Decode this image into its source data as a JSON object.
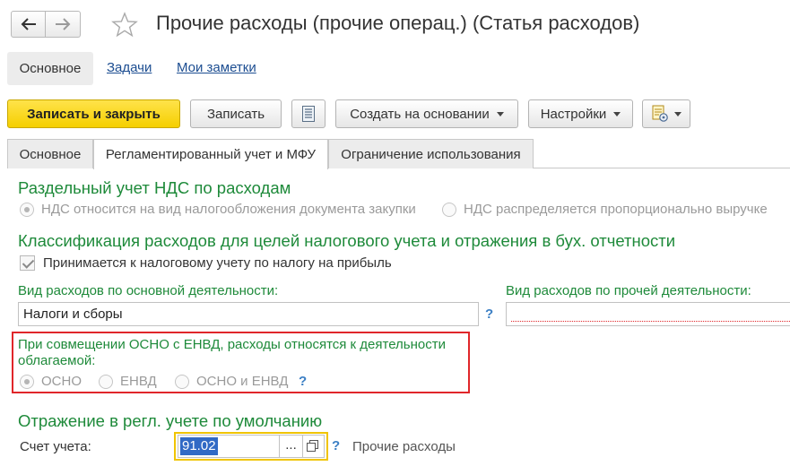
{
  "window": {
    "title": "Прочие расходы (прочие операц.) (Статья расходов)"
  },
  "nav": {
    "back_icon": "arrow-left-icon",
    "forward_icon": "arrow-right-icon",
    "favorite_icon": "star-outline-icon"
  },
  "subnav": {
    "main": "Основное",
    "tasks": "Задачи",
    "notes": "Мои заметки"
  },
  "toolbar": {
    "save_close": "Записать и закрыть",
    "save": "Записать",
    "list_icon": "document-list-icon",
    "create_based": "Создать на основании",
    "settings": "Настройки",
    "report_icon": "report-gear-icon"
  },
  "tabs": [
    {
      "label": "Основное"
    },
    {
      "label": "Регламентированный учет и МФУ"
    },
    {
      "label": "Ограничение использования"
    }
  ],
  "vat": {
    "heading": "Раздельный учет НДС по расходам",
    "option1": "НДС относится на вид налогообложения документа закупки",
    "option2": "НДС распределяется пропорционально выручке"
  },
  "classification": {
    "heading": "Классификация расходов для целей налогового учета и отражения в бух. отчетности",
    "checkbox_label": "Принимается к налоговому учету по налогу на прибыль",
    "main_activity_label": "Вид расходов по основной деятельности:",
    "main_activity_value": "Налоги и сборы",
    "other_activity_label": "Вид расходов по прочей деятельности:",
    "other_activity_value": "",
    "help": "?"
  },
  "envd": {
    "text_line1": "При совмещении ОСНО с ЕНВД, расходы относятся к деятельности",
    "text_line2": "облагаемой:",
    "osno": "ОСНО",
    "envd": "ЕНВД",
    "both": "ОСНО и ЕНВД",
    "help": "?"
  },
  "accounting": {
    "heading": "Отражение в регл. учете по умолчанию",
    "account_label": "Счет учета:",
    "account_value": "91.02",
    "select_button": "...",
    "open_icon": "open-copy-icon",
    "help": "?",
    "account_name": "Прочие расходы"
  },
  "colors": {
    "accent_green": "#1e8a3a",
    "primary_yellow": "#f5cf00",
    "highlight_red": "#e0262a",
    "link_blue": "#1c4d91"
  }
}
